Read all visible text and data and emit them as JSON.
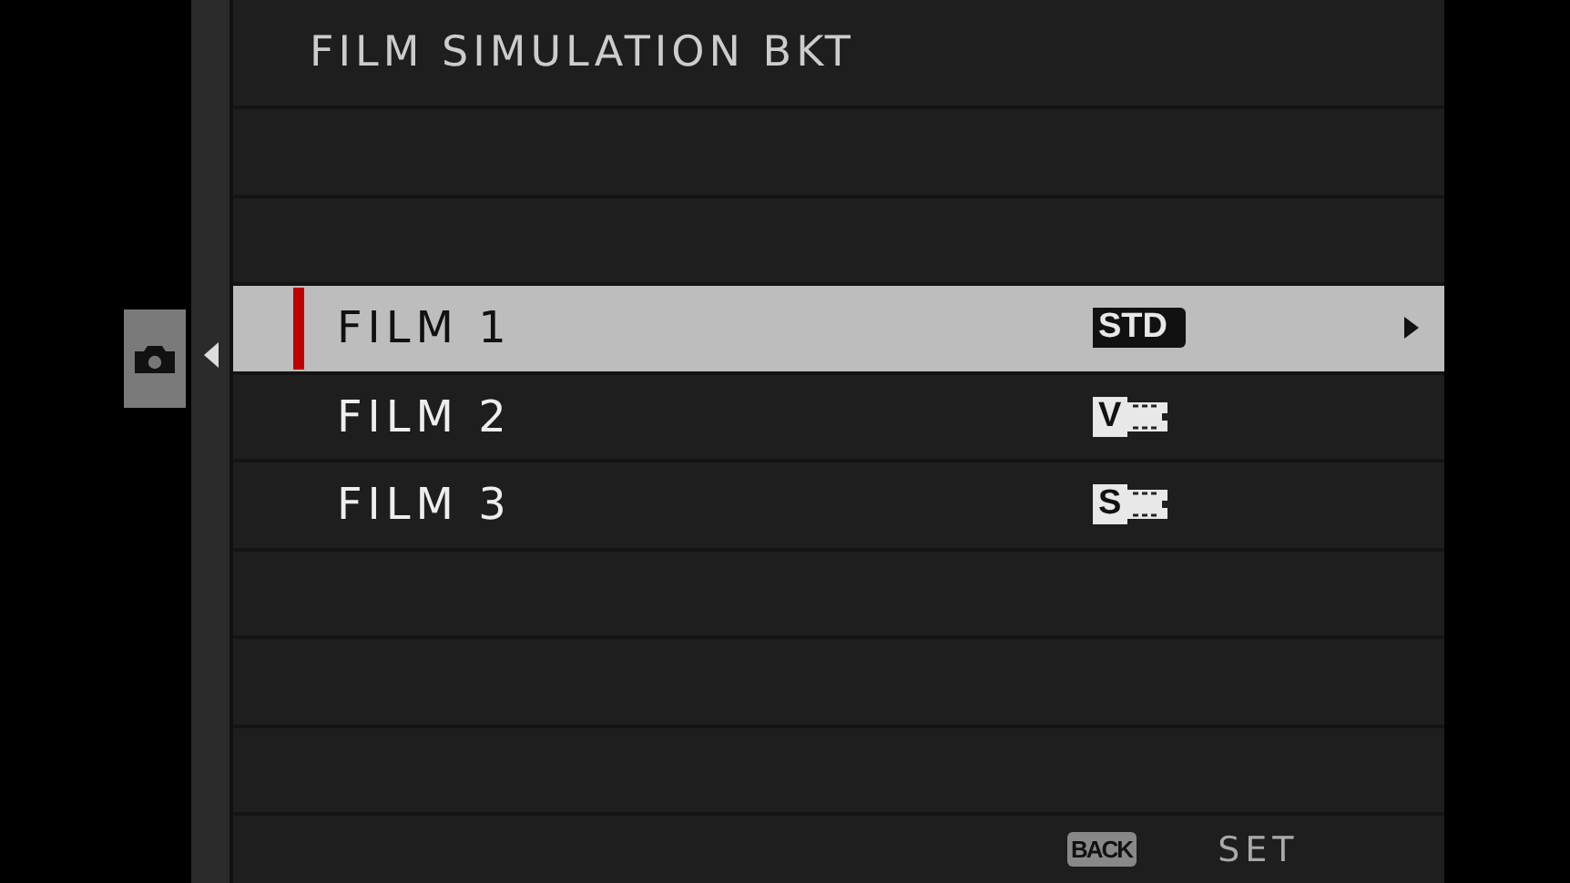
{
  "title": "FILM SIMULATION BKT",
  "tabs": [
    {
      "kind": "camera",
      "selected": true
    }
  ],
  "items": [
    {
      "label": "FILM 1",
      "badge": "STD",
      "selected": true
    },
    {
      "label": "FILM 2",
      "badge": "V",
      "selected": false
    },
    {
      "label": "FILM 3",
      "badge": "S",
      "selected": false
    }
  ],
  "footer": {
    "back": "BACK",
    "set": "SET"
  }
}
